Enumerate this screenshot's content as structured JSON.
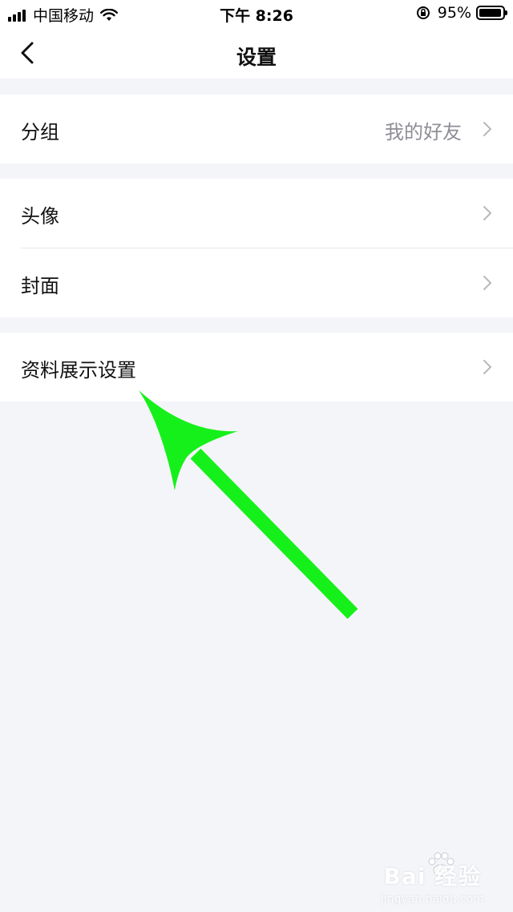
{
  "status_bar": {
    "carrier": "中国移动",
    "time": "下午 8:26",
    "battery_percent": "95%",
    "battery_level": 0.95
  },
  "nav": {
    "title": "设置",
    "back_icon": "chevron-left-icon"
  },
  "groups": [
    {
      "rows": [
        {
          "label": "分组",
          "value": "我的好友"
        }
      ]
    },
    {
      "rows": [
        {
          "label": "头像",
          "value": ""
        },
        {
          "label": "封面",
          "value": ""
        }
      ]
    },
    {
      "rows": [
        {
          "label": "资料展示设置",
          "value": ""
        }
      ]
    }
  ],
  "colors": {
    "background": "#f4f5f9",
    "row_background": "#ffffff",
    "secondary_text": "#8e8e96",
    "chevron": "#b8b8be",
    "annotation_arrow": "#16f01a"
  },
  "watermark": {
    "main": "Bai 经验",
    "sub": "jingyan.baidu.com"
  }
}
